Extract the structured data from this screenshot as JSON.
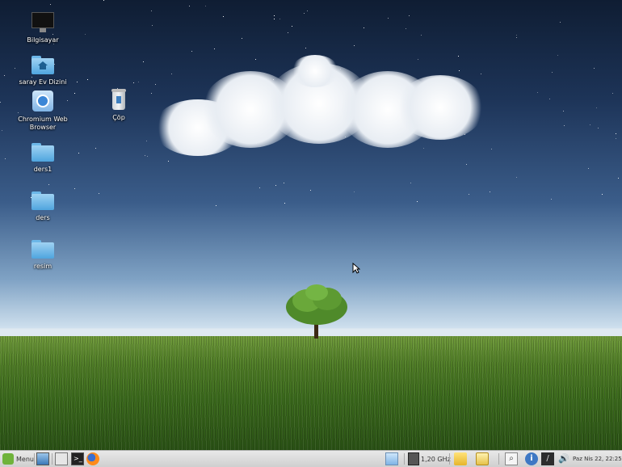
{
  "desktop": {
    "icons": [
      {
        "label": "Bilgisayar",
        "icon": "computer-icon"
      },
      {
        "label": "saray Ev Dizini",
        "icon": "home-folder-icon"
      },
      {
        "label": "Chromium Web Browser",
        "icon": "chromium-icon"
      },
      {
        "label": "ders1",
        "icon": "folder-icon"
      },
      {
        "label": "ders",
        "icon": "folder-icon"
      },
      {
        "label": "resim",
        "icon": "folder-icon"
      },
      {
        "label": "Çöp",
        "icon": "trash-icon"
      }
    ]
  },
  "taskbar": {
    "menu_label": "Menu",
    "cpu_freq": "1,20 GHz",
    "clock": "Paz Nis 22, 22:25"
  },
  "colors": {
    "sky_top": "#0f1d33",
    "horizon": "#dfe9f1",
    "grass": "#4f7d26",
    "folder": "#4fa5df",
    "taskbar": "#dcdcdc"
  }
}
